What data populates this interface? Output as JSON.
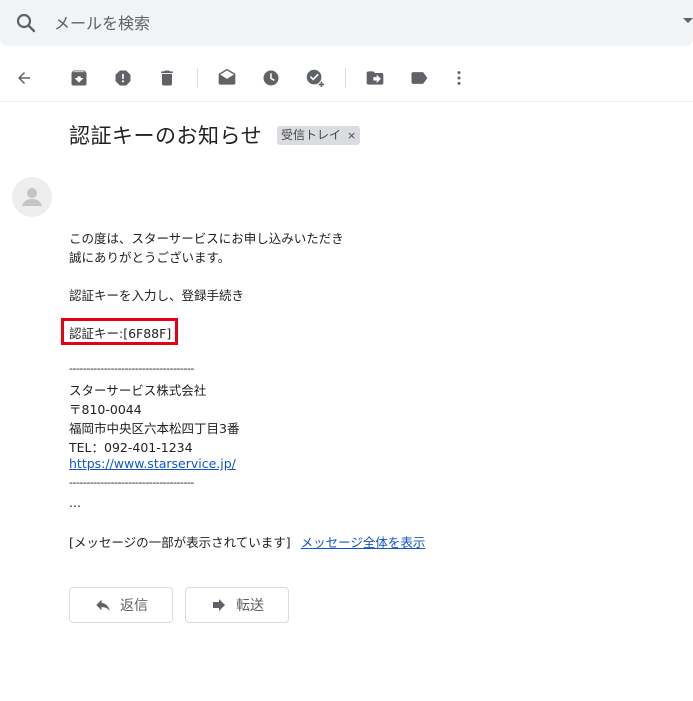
{
  "search": {
    "placeholder": "メールを検索"
  },
  "toolbar": {
    "icons": [
      "back-arrow-icon",
      "archive-icon",
      "report-spam-icon",
      "delete-icon",
      "mark-unread-icon",
      "snooze-icon",
      "add-to-tasks-icon",
      "move-to-icon",
      "labels-icon",
      "more-vert-icon"
    ]
  },
  "message": {
    "subject": "認証キーのお知らせ",
    "label": "受信トレイ",
    "label_close": "×",
    "lines": {
      "l1": "この度は、スターサービスにお申し込みいただき",
      "l2": "誠にありがとうございます。",
      "l3": "認証キーを入力し、登録手続き",
      "key": "認証キー:[6F88F]",
      "sep1": "------------------------------------",
      "company": "スターサービス株式会社",
      "zip": "〒810-0044",
      "address": "福岡市中央区六本松四丁目3番",
      "tel": "TEL：092-401-1234",
      "url": "https://www.starservice.jp/",
      "sep2": "------------------------------------",
      "ellipsis": "...",
      "clipped": "[メッセージの一部が表示されています]",
      "view_full": "メッセージ全体を表示"
    }
  },
  "actions": {
    "reply": "返信",
    "forward": "転送"
  },
  "colors": {
    "highlight_box": "#e60012",
    "link": "#1155cc"
  }
}
